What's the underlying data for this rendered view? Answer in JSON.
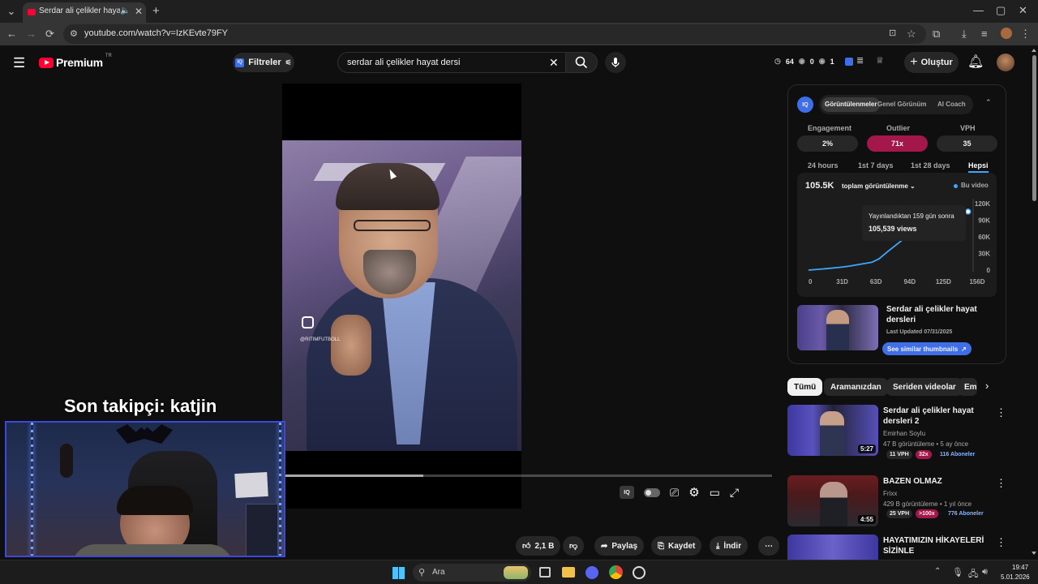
{
  "browser": {
    "tab_title": "Serdar ali çelikler hayat de",
    "url": "youtube.com/watch?v=IzKEvte79FY"
  },
  "header": {
    "logo_text": "Premium",
    "logo_region": "TR",
    "filter_label": "Filtreler",
    "search_value": "serdar ali çelikler hayat dersi",
    "stats": [
      "64",
      "0",
      "1"
    ],
    "create_label": "Oluştur"
  },
  "iq_panel": {
    "tabs": [
      "Görüntülenmeler",
      "Genel Görünüm",
      "AI Coach"
    ],
    "metric_labels": [
      "Engagement",
      "Outlier",
      "VPH"
    ],
    "metric_values": [
      "2%",
      "71x",
      "35"
    ],
    "ranges": [
      "24 hours",
      "1st 7 days",
      "1st 28 days",
      "Hepsi"
    ],
    "total_views": "105.5K",
    "views_dropdown": "toplam görüntülenme",
    "legend": "Bu video",
    "tooltip_line1": "Yayınlandıktan 159 gün sonra",
    "tooltip_line2": "105,539 views",
    "video_title": "Serdar ali çelikler hayat dersleri",
    "last_updated": "Last Updated 07/31/2025",
    "similar_label": "See similar thumbnails"
  },
  "chart_data": {
    "type": "line",
    "x": [
      0,
      10,
      20,
      31,
      40,
      50,
      63,
      70,
      80,
      94,
      105,
      115,
      125,
      135,
      159
    ],
    "y": [
      0,
      1500,
      3000,
      5000,
      7000,
      10000,
      14000,
      20000,
      35000,
      55000,
      72000,
      85000,
      95000,
      100000,
      105539
    ],
    "x_ticks": [
      "0",
      "31D",
      "63D",
      "94D",
      "125D",
      "156D"
    ],
    "y_ticks": [
      "120K",
      "90K",
      "60K",
      "30K",
      "0"
    ],
    "xlim": [
      0,
      160
    ],
    "ylim": [
      0,
      120000
    ],
    "color": "#3ea6ff"
  },
  "chips": [
    "Tümü",
    "Aramanızdan",
    "Seriden videolar",
    "Em"
  ],
  "related": [
    {
      "title": "Serdar ali çelikler hayat dersleri 2",
      "channel": "Emirhan Soylu",
      "meta": "47 B görüntüleme • 5 ay önce",
      "vph": "11 VPH",
      "outlier": "32x",
      "subs": "116 Aboneler",
      "duration": "5:27"
    },
    {
      "title": "BAZEN OLMAZ",
      "channel": "Frixx",
      "meta": "429 B görüntüleme • 1 yıl önce",
      "vph": "25 VPH",
      "outlier": ">100x",
      "subs": "776 Aboneler",
      "duration": "4:55"
    },
    {
      "title": "HAYATIMIZIN HİKAYELERİ SİZİNLE",
      "channel": "",
      "meta": "",
      "vph": "",
      "outlier": "",
      "subs": "",
      "duration": ""
    }
  ],
  "actions": {
    "likes": "2,1 B",
    "share": "Paylaş",
    "save": "Kaydet",
    "download": "İndir"
  },
  "overlay": {
    "follower_text": "Son takipçi: katjin",
    "watermark": "@RITIMFUTBOLL"
  },
  "taskbar": {
    "search_placeholder": "Ara",
    "time": "19:47",
    "date": "5.01.2026"
  },
  "colors": {
    "accent_red": "#ff0033",
    "outlier_pink": "#a3174a",
    "link_blue": "#3ea6ff",
    "similar_btn": "#3e6ee8"
  }
}
